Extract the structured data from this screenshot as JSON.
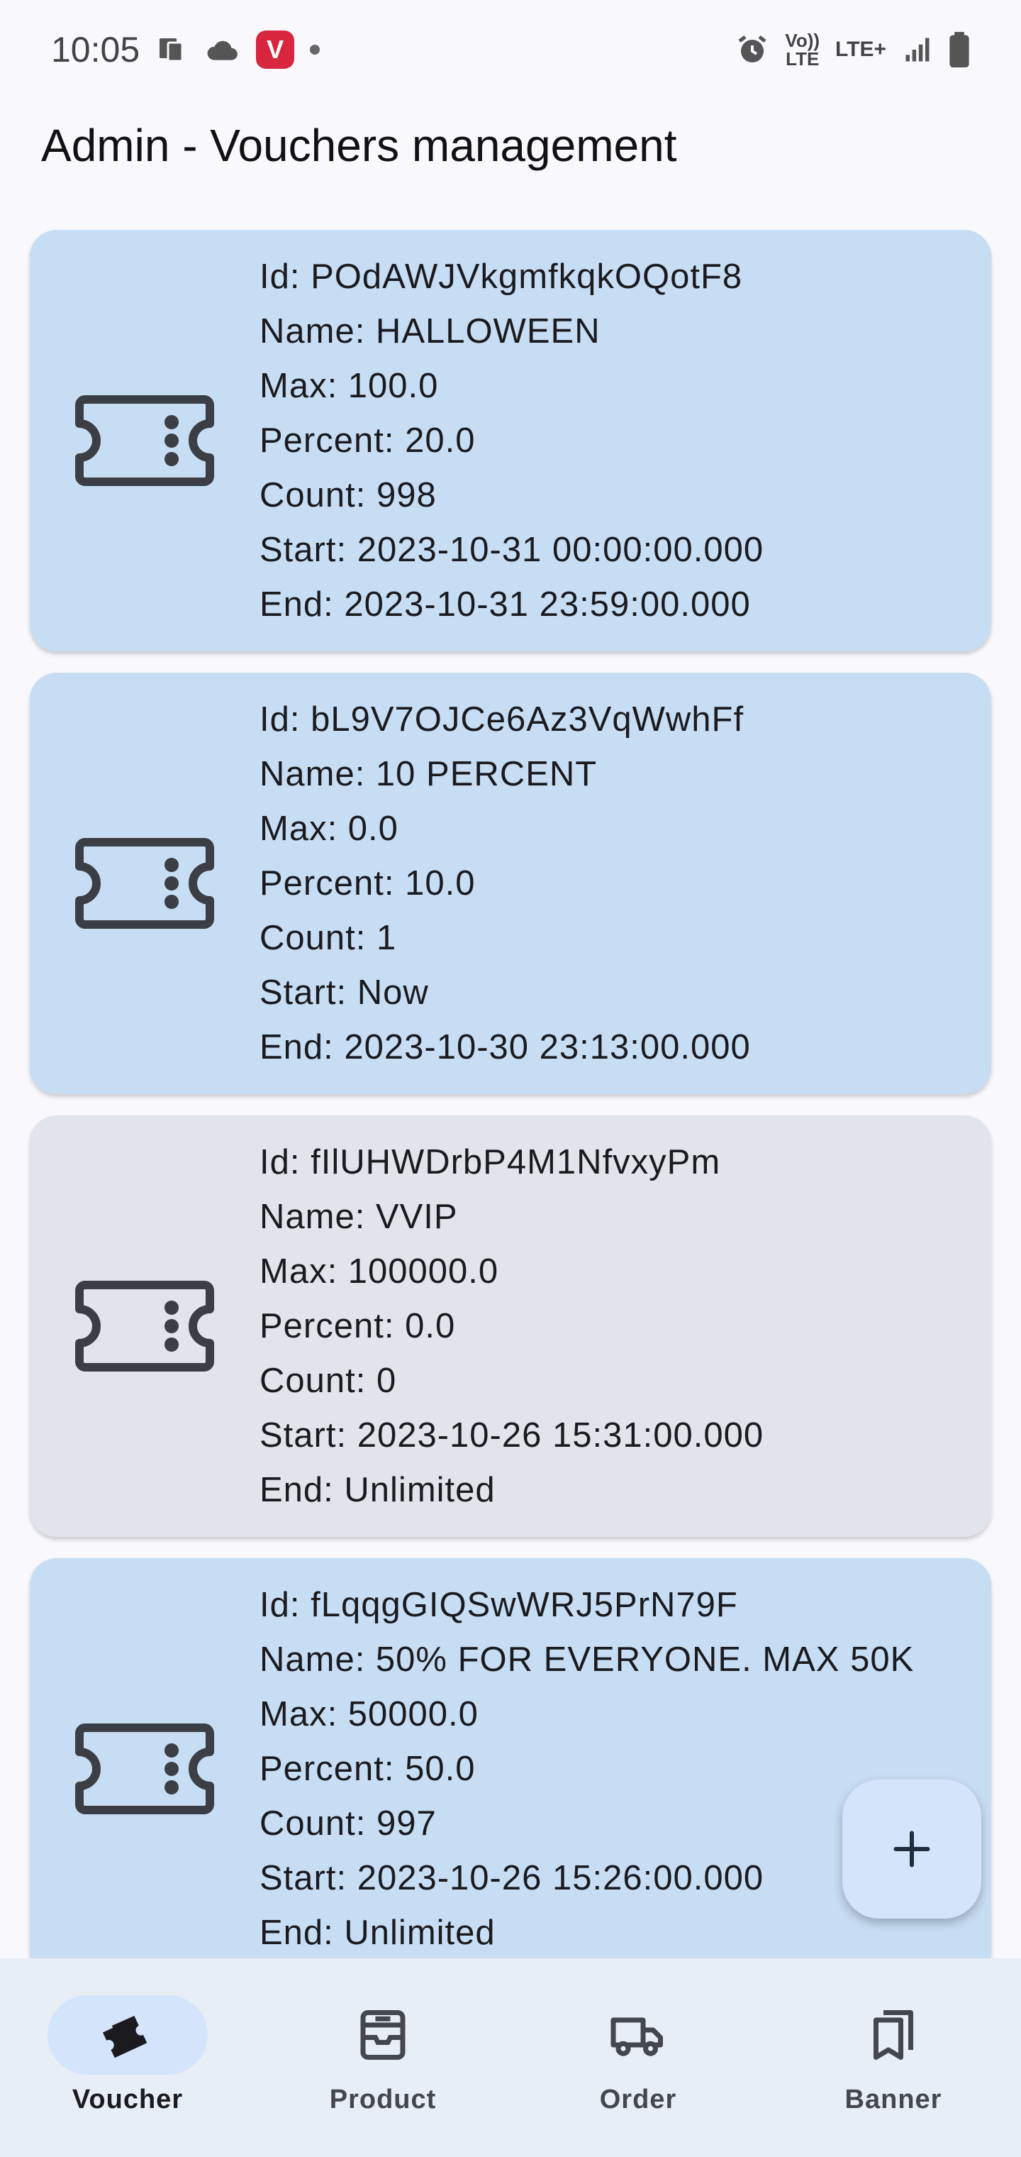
{
  "status_bar": {
    "time": "10:05",
    "app_badge": "V",
    "volte": "Vo))\nLTE",
    "lte": "LTE+"
  },
  "page": {
    "title": "Admin - Vouchers management"
  },
  "vouchers": [
    {
      "active": true,
      "id": "Id: POdAWJVkgmfkqkOQotF8",
      "name": "Name: HALLOWEEN",
      "max": "Max: 100.0",
      "percent": "Percent: 20.0",
      "count": "Count: 998",
      "start": "Start: 2023-10-31 00:00:00.000",
      "end": "End: 2023-10-31 23:59:00.000"
    },
    {
      "active": true,
      "id": "Id: bL9V7OJCe6Az3VqWwhFf",
      "name": "Name: 10 PERCENT",
      "max": "Max: 0.0",
      "percent": "Percent: 10.0",
      "count": "Count: 1",
      "start": "Start: Now",
      "end": "End: 2023-10-30 23:13:00.000"
    },
    {
      "active": false,
      "id": "Id: fIlUHWDrbP4M1NfvxyPm",
      "name": "Name: VVIP",
      "max": "Max: 100000.0",
      "percent": "Percent: 0.0",
      "count": "Count: 0",
      "start": "Start: 2023-10-26 15:31:00.000",
      "end": "End: Unlimited"
    },
    {
      "active": true,
      "id": "Id: fLqqgGIQSwWRJ5PrN79F",
      "name": "Name: 50% FOR EVERYONE. MAX 50K",
      "max": "Max: 50000.0",
      "percent": "Percent: 50.0",
      "count": "Count: 997",
      "start": "Start: 2023-10-26 15:26:00.000",
      "end": "End: Unlimited"
    }
  ],
  "fab": {
    "icon": "add-icon"
  },
  "bottom_nav": {
    "items": [
      {
        "label": "Voucher",
        "icon": "voucher-icon",
        "active": true
      },
      {
        "label": "Product",
        "icon": "product-icon",
        "active": false
      },
      {
        "label": "Order",
        "icon": "truck-icon",
        "active": false
      },
      {
        "label": "Banner",
        "icon": "bookmarks-icon",
        "active": false
      }
    ]
  },
  "colors": {
    "card_active": "#c7ddf4",
    "card_inactive": "#e1e4ea",
    "nav_background": "#e8eef5",
    "nav_indicator": "#d3e4fb"
  }
}
